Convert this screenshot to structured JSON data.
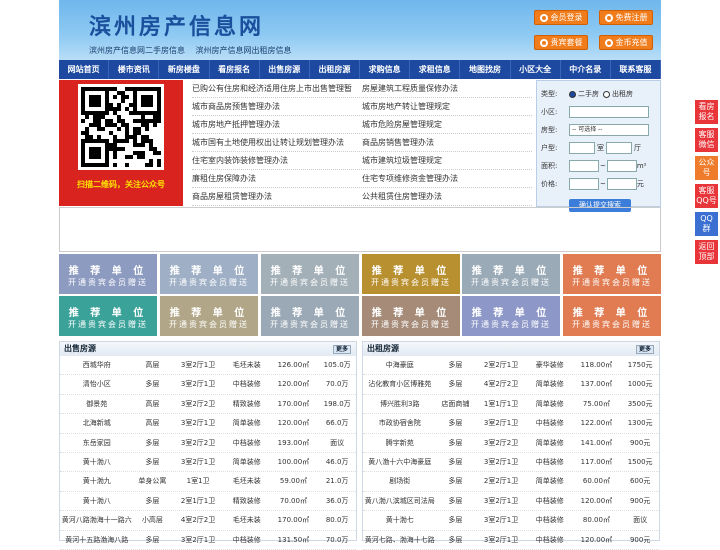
{
  "header": {
    "title": "滨州房产信息网",
    "sub1": "滨州房产信息网二手房信息",
    "sub2": "滨州房产信息网出租房信息",
    "buttons": [
      "会员登录",
      "免费注册",
      "贵宾套餐",
      "金币充值"
    ]
  },
  "nav": [
    "网站首页",
    "楼市资讯",
    "新房楼盘",
    "看房报名",
    "出售房源",
    "出租房源",
    "求购信息",
    "求租信息",
    "地图找房",
    "小区大全",
    "中介名录",
    "联系客服"
  ],
  "qr_caption": "扫描二维码，关注公众号",
  "links": [
    [
      "已购公有住房和经济适用住房上市出售管理暂",
      "房屋建筑工程质量保修办法"
    ],
    [
      "城市商品房预售管理办法",
      "城市房地产转让管理规定"
    ],
    [
      "城市房地产抵押管理办法",
      "城市危险房屋管理规定"
    ],
    [
      "城市国有土地使用权出让转让规划管理办法",
      "商品房销售管理办法"
    ],
    [
      "住宅室内装饰装修管理办法",
      "城市建筑垃圾管理规定"
    ],
    [
      "廉租住房保障办法",
      "住宅专项维修资金管理办法"
    ],
    [
      "商品房屋租赁管理办法",
      "公共租赁住房管理办法"
    ]
  ],
  "search": {
    "type_label": "类型:",
    "type_opt1": "二手房",
    "type_opt2": "出租房",
    "area_label": "小区:",
    "kind_label": "房型:",
    "kind_value": "-- 可选择 --",
    "layout_label": "户型:",
    "layout_room": "室",
    "layout_hall": "厅",
    "size_label": "面积:",
    "size_unit": "m²",
    "price_label": "价格:",
    "price_unit": "元",
    "submit": "确认提交搜索"
  },
  "promo": {
    "line1": "推 荐 单 位",
    "line2": "开通贵宾会员赠送",
    "colors": [
      "#8d9bc1",
      "#9fb0c6",
      "#a3b0b8",
      "#b9902f",
      "#9aaab7",
      "#e07b52",
      "#3ba29a",
      "#b1a687",
      "#9aa9b5",
      "#a58b78",
      "#8d97c8",
      "#e07b52"
    ]
  },
  "sale": {
    "title": "出售房源",
    "more": "更多",
    "rows": [
      [
        "西城华府",
        "高层",
        "3室2厅1卫",
        "毛坯未装",
        "126.00㎡",
        "105.0万"
      ],
      [
        "清怡小区",
        "多层",
        "3室2厅1卫",
        "中档装修",
        "120.00㎡",
        "70.0万"
      ],
      [
        "御景苑",
        "高层",
        "3室2厅2卫",
        "精致装修",
        "170.00㎡",
        "198.0万"
      ],
      [
        "北海新城",
        "高层",
        "3室2厅1卫",
        "简单装修",
        "120.00㎡",
        "66.0万"
      ],
      [
        "东岳家园",
        "多层",
        "3室2厅2卫",
        "中档装修",
        "193.00㎡",
        "面议"
      ],
      [
        "黄十渤八",
        "多层",
        "3室2厅1卫",
        "简单装修",
        "100.00㎡",
        "46.0万"
      ],
      [
        "黄十渤九",
        "单身公寓",
        "1室1卫",
        "毛坯未装",
        "59.00㎡",
        "21.0万"
      ],
      [
        "黄十渤八",
        "多层",
        "2室1厅1卫",
        "精致装修",
        "70.00㎡",
        "36.0万"
      ],
      [
        "黄河八路渤海十一路六",
        "小高层",
        "4室2厅2卫",
        "毛坯未装",
        "170.00㎡",
        "80.0万"
      ],
      [
        "黄河十五路渤海八路",
        "多层",
        "3室2厅1卫",
        "中档装修",
        "131.50㎡",
        "70.0万"
      ]
    ]
  },
  "rent": {
    "title": "出租房源",
    "more": "更多",
    "rows": [
      [
        "中海豪庭",
        "多层",
        "2室2厅1卫",
        "豪华装修",
        "118.00㎡",
        "1750元"
      ],
      [
        "沾化教育小区博雅苑",
        "多层",
        "4室2厅2卫",
        "简单装修",
        "137.00㎡",
        "1000元"
      ],
      [
        "博兴胜利3路",
        "店面商铺",
        "1室1厅1卫",
        "简单装修",
        "75.00㎡",
        "3500元"
      ],
      [
        "市政协宿舍院",
        "多层",
        "3室2厅1卫",
        "中档装修",
        "122.00㎡",
        "1300元"
      ],
      [
        "腾宇新苑",
        "多层",
        "3室2厅2卫",
        "简单装修",
        "141.00㎡",
        "900元"
      ],
      [
        "黄八渤十六中海豪庭",
        "多层",
        "3室2厅1卫",
        "中档装修",
        "117.00㎡",
        "1500元"
      ],
      [
        "剧场街",
        "多层",
        "2室2厅1卫",
        "简单装修",
        "60.00㎡",
        "600元"
      ],
      [
        "黄八渤八滨城区司法局",
        "多层",
        "3室2厅1卫",
        "中档装修",
        "120.00㎡",
        "900元"
      ],
      [
        "黄十渤七",
        "多层",
        "3室2厅1卫",
        "中档装修",
        "80.00㎡",
        "面议"
      ],
      [
        "黄河七路、渤海十七路",
        "多层",
        "3室2厅1卫",
        "中档装修",
        "120.00㎡",
        "900元"
      ]
    ]
  },
  "side": [
    [
      "看房",
      "报名"
    ],
    [
      "客服",
      "微信"
    ],
    [
      "公众",
      "号"
    ],
    [
      "客服",
      "QQ号"
    ],
    [
      "QQ",
      "群"
    ],
    [
      "返回",
      "顶部"
    ]
  ]
}
